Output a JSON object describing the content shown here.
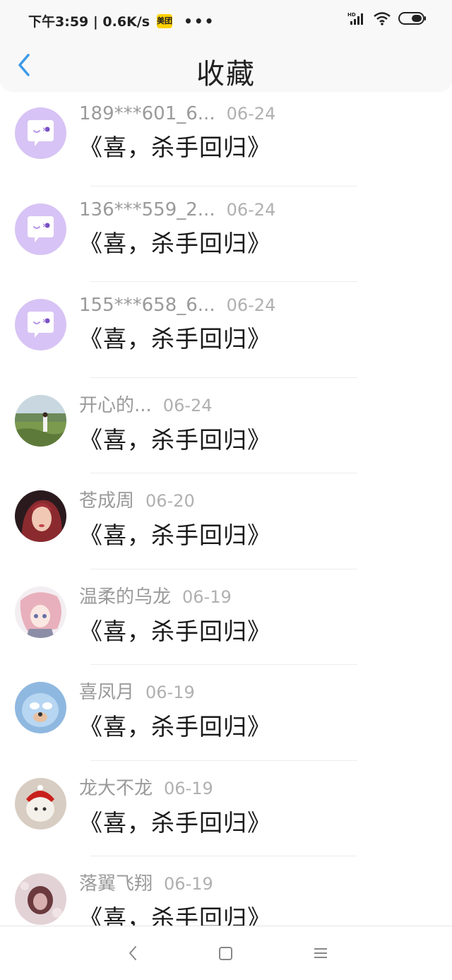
{
  "status_bar": {
    "time_speed": "下午3:59 | 0.6K/s",
    "app_badge": "美团",
    "dots": "•••",
    "network_type": "HD"
  },
  "header": {
    "title": "收藏"
  },
  "list": [
    {
      "name": "189***601_6...",
      "date": "06-24",
      "title": "《喜，杀手回归》",
      "avatar": "default"
    },
    {
      "name": "136***559_2...",
      "date": "06-24",
      "title": "《喜，杀手回归》",
      "avatar": "default"
    },
    {
      "name": "155***658_6...",
      "date": "06-24",
      "title": "《喜，杀手回归》",
      "avatar": "default"
    },
    {
      "name": "开心的...",
      "date": "06-24",
      "title": "《喜，杀手回归》",
      "avatar": "photo"
    },
    {
      "name": "苍成周",
      "date": "06-20",
      "title": "《喜，杀手回归》",
      "avatar": "photo"
    },
    {
      "name": "温柔的乌龙",
      "date": "06-19",
      "title": "《喜，杀手回归》",
      "avatar": "photo"
    },
    {
      "name": "喜凤月",
      "date": "06-19",
      "title": "《喜，杀手回归》",
      "avatar": "photo"
    },
    {
      "name": "龙大不龙",
      "date": "06-19",
      "title": "《喜，杀手回归》",
      "avatar": "photo"
    },
    {
      "name": "落翼飞翔",
      "date": "06-19",
      "title": "《喜，杀手回归》",
      "avatar": "photo"
    }
  ],
  "icons": {
    "back": "chevron-left-icon",
    "nav_back": "nav-back-icon",
    "nav_home": "nav-home-icon",
    "nav_menu": "nav-menu-icon"
  },
  "colors": {
    "accent": "#3d9ae8",
    "default_avatar": "#d7c3f5"
  }
}
